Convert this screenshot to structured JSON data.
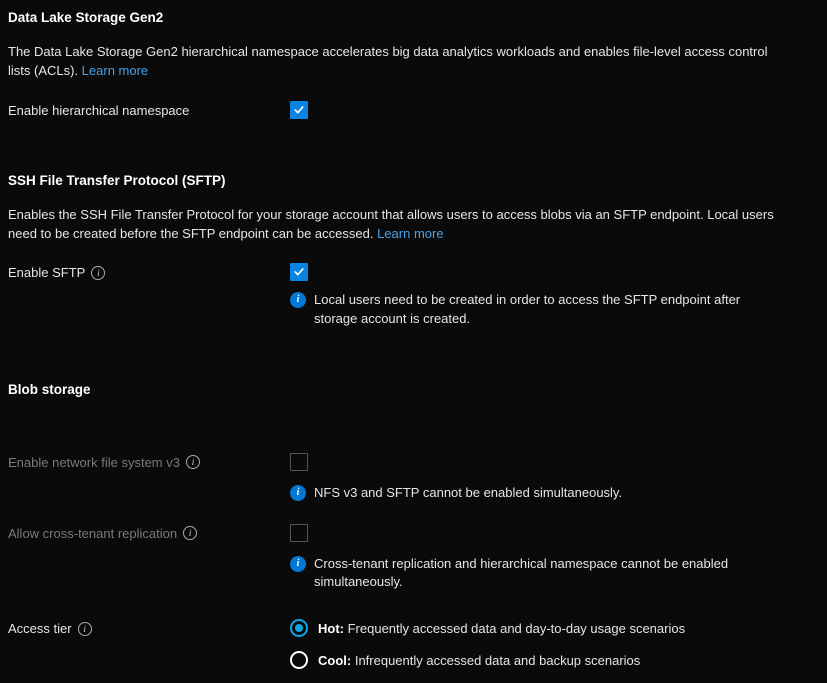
{
  "dataLake": {
    "heading": "Data Lake Storage Gen2",
    "desc": "The Data Lake Storage Gen2 hierarchical namespace accelerates big data analytics workloads and enables file-level access control lists (ACLs). ",
    "learnMore": "Learn more",
    "hnsLabel": "Enable hierarchical namespace",
    "hnsChecked": true
  },
  "sftp": {
    "heading": "SSH File Transfer Protocol (SFTP)",
    "desc": "Enables the SSH File Transfer Protocol for your storage account that allows users to access blobs via an SFTP endpoint. Local users need to be created before the SFTP endpoint can be accessed. ",
    "learnMore": "Learn more",
    "enableLabel": "Enable SFTP",
    "enableChecked": true,
    "note": "Local users need to be created in order to access the SFTP endpoint after storage account is created."
  },
  "blob": {
    "heading": "Blob storage",
    "nfsLabel": "Enable network file system v3",
    "nfsNote": "NFS v3 and SFTP cannot be enabled simultaneously.",
    "crossTenantLabel": "Allow cross-tenant replication",
    "crossTenantNote": "Cross-tenant replication and hierarchical namespace cannot be enabled simultaneously.",
    "accessTierLabel": "Access tier",
    "tiers": {
      "hotPrefix": "Hot:",
      "hotDesc": " Frequently accessed data and day-to-day usage scenarios",
      "coolPrefix": "Cool:",
      "coolDesc": " Infrequently accessed data and backup scenarios"
    }
  }
}
